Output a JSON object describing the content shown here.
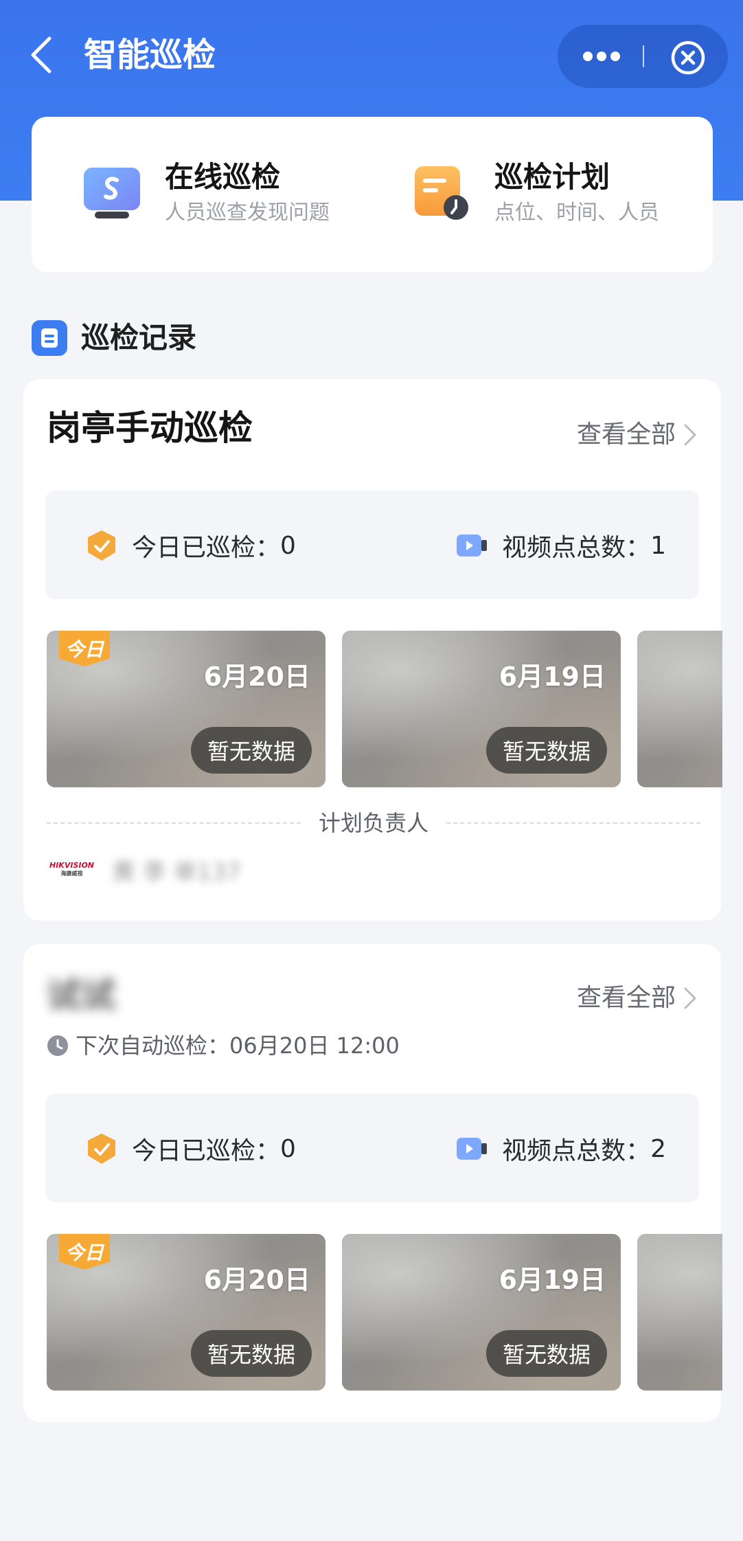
{
  "header": {
    "title": "智能巡检"
  },
  "quick_actions": [
    {
      "title": "在线巡检",
      "subtitle": "人员巡查发现问题",
      "icon": "monitor-icon"
    },
    {
      "title": "巡检计划",
      "subtitle": "点位、时间、人员",
      "icon": "plan-clock-icon"
    }
  ],
  "records": {
    "title": "巡检记录",
    "cards": [
      {
        "title": "岗亭手动巡检",
        "view_all": "查看全部",
        "stats": {
          "patrolled_label": "今日已巡检：",
          "patrolled_value": "0",
          "points_label": "视频点总数：",
          "points_value": "1"
        },
        "thumbs": [
          {
            "date": "6月20日",
            "status": "暂无数据",
            "today_badge": "今日"
          },
          {
            "date": "6月19日",
            "status": "暂无数据"
          }
        ],
        "divider_label": "计划负责人",
        "owner": {
          "logo_text": "HIKVISION",
          "logo_sub": "海康威视",
          "name": "黄 李 单137"
        }
      },
      {
        "title": "试试",
        "view_all": "查看全部",
        "schedule": "下次自动巡检：06月20日 12:00",
        "stats": {
          "patrolled_label": "今日已巡检：",
          "patrolled_value": "0",
          "points_label": "视频点总数：",
          "points_value": "2"
        },
        "thumbs": [
          {
            "date": "6月20日",
            "status": "暂无数据",
            "today_badge": "今日"
          },
          {
            "date": "6月19日",
            "status": "暂无数据"
          }
        ]
      }
    ]
  },
  "colors": {
    "brand_blue": "#3a74ec",
    "today_badge": "#f6a935",
    "page_bg": "#f3f5f9"
  }
}
